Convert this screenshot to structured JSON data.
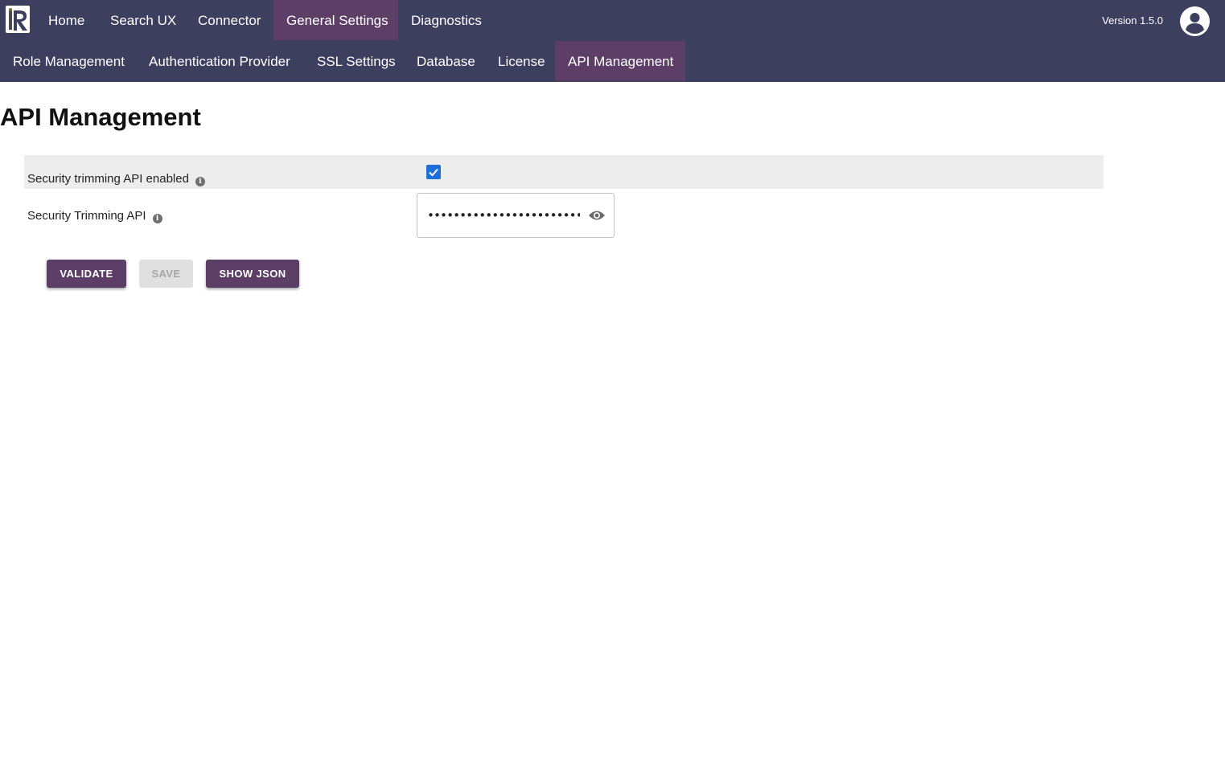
{
  "app": {
    "logo_letter": "R",
    "version": "Version 1.5.0"
  },
  "nav": {
    "items": [
      {
        "label": "Home"
      },
      {
        "label": "Search UX"
      },
      {
        "label": "Connector"
      },
      {
        "label": "General Settings",
        "active": true
      },
      {
        "label": "Diagnostics"
      }
    ]
  },
  "subnav": {
    "items": [
      {
        "label": "Role Management"
      },
      {
        "label": "Authentication Provider"
      },
      {
        "label": "SSL Settings"
      },
      {
        "label": "Database"
      },
      {
        "label": "License"
      },
      {
        "label": "API Management",
        "active": true
      }
    ]
  },
  "page": {
    "title": "API Management"
  },
  "fields": {
    "enabled": {
      "label": "Security trimming API enabled",
      "checked": true
    },
    "api": {
      "label": "Security Trimming API",
      "value": "••••••••••••••••••••••••"
    }
  },
  "actions": {
    "validate": "VALIDATE",
    "save": "SAVE",
    "show_json": "SHOW JSON"
  },
  "colors": {
    "header_bg": "#3d3f5e",
    "active_tab": "#5c3e66",
    "checkbox": "#1e6fd9"
  },
  "icons": {
    "info": "info-icon",
    "eye": "eye-icon",
    "avatar": "account-circle-icon",
    "check": "check-icon"
  }
}
